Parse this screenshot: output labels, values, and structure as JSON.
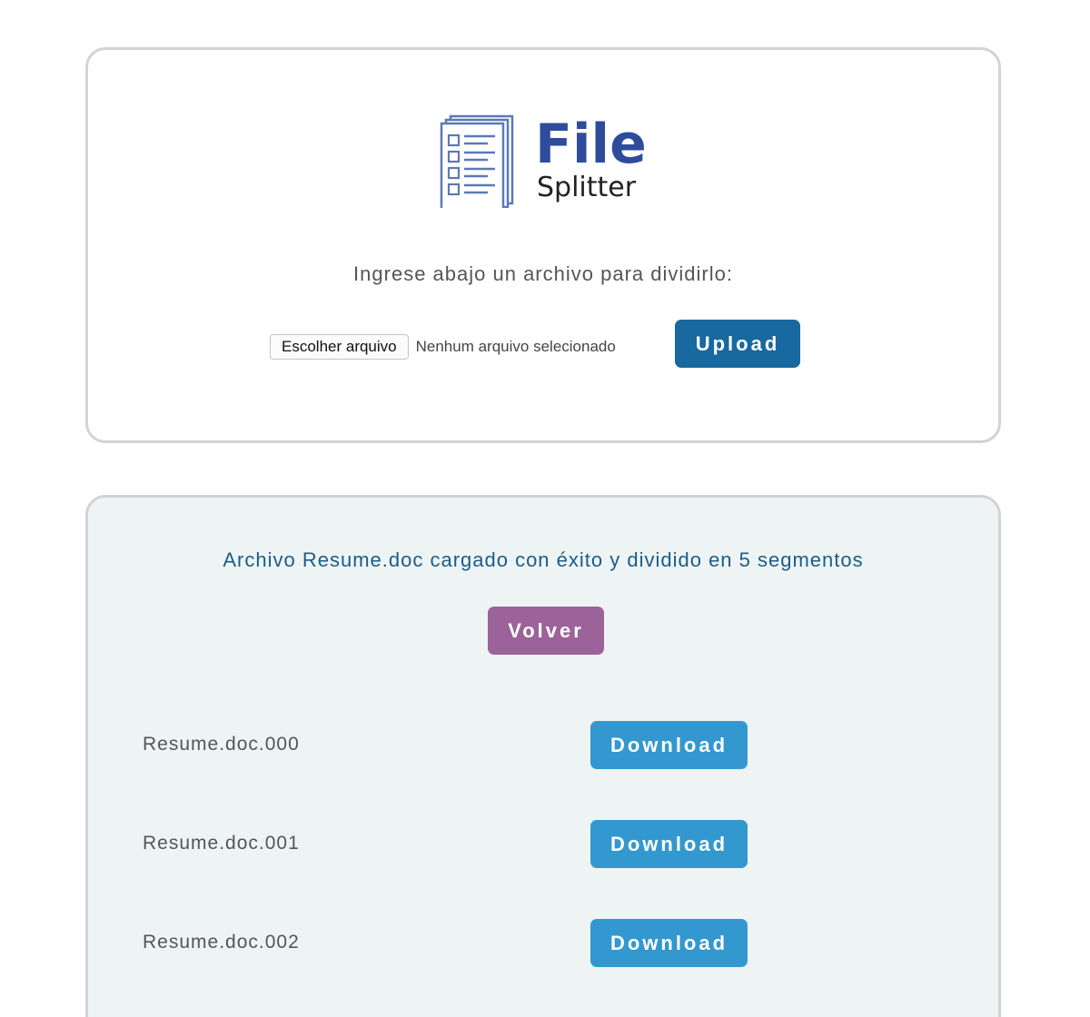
{
  "upload": {
    "logo": {
      "word_main": "File",
      "word_sub": "Splitter",
      "icon": "document-list-icon",
      "brand_color": "#2f4c9c"
    },
    "prompt": "Ingrese abajo un archivo para dividirlo:",
    "choose_label": "Escolher arquivo",
    "no_file_label": "Nenhum arquivo selecionado",
    "upload_label": "Upload"
  },
  "result": {
    "message": "Archivo Resume.doc cargado con éxito y dividido en 5 segmentos",
    "back_label": "Volver",
    "segments": [
      {
        "name": "Resume.doc.000",
        "download_label": "Download"
      },
      {
        "name": "Resume.doc.001",
        "download_label": "Download"
      },
      {
        "name": "Resume.doc.002",
        "download_label": "Download"
      }
    ]
  },
  "colors": {
    "upload_button": "#1769a0",
    "back_button": "#9b6399",
    "download_button": "#3398cf",
    "message_text": "#1c5c87",
    "result_background": "#eef4f4"
  }
}
